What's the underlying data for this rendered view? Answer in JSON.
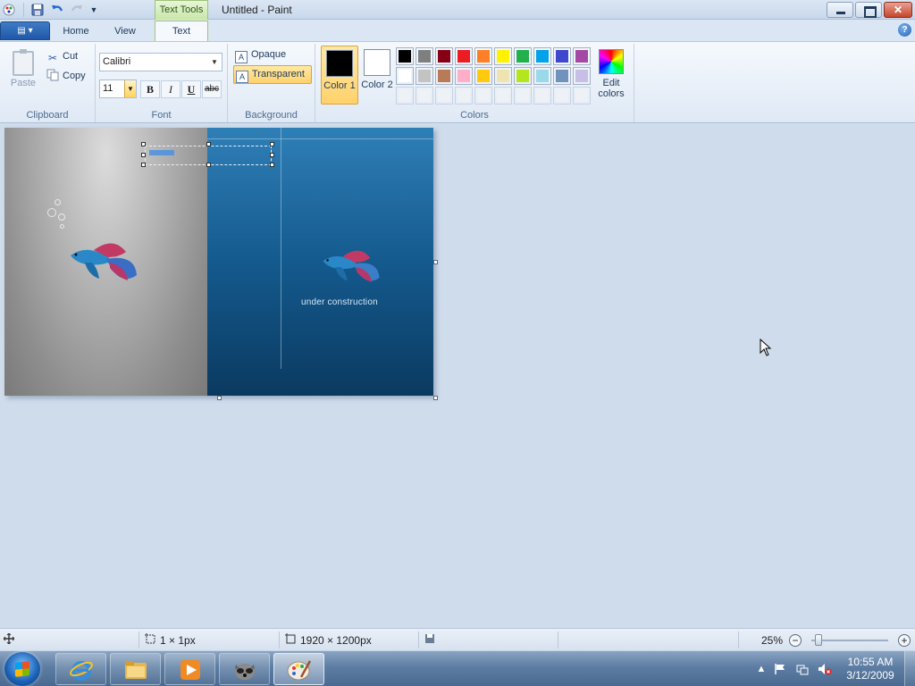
{
  "window": {
    "title": "Untitled - Paint",
    "contextual_tab_group": "Text Tools"
  },
  "tabs": {
    "home": "Home",
    "view": "View",
    "text": "Text"
  },
  "clipboard": {
    "paste": "Paste",
    "cut": "Cut",
    "copy": "Copy",
    "group": "Clipboard"
  },
  "font": {
    "family": "Calibri",
    "size": "11",
    "bold": "B",
    "italic": "I",
    "underline": "U",
    "strike": "abc",
    "group": "Font"
  },
  "background": {
    "opaque": "Opaque",
    "transparent": "Transparent",
    "group": "Background",
    "selected": "Transparent"
  },
  "colors": {
    "color1_label": "Color 1",
    "color2_label": "Color 2",
    "edit_label": "Edit colors",
    "group": "Colors",
    "color1": "#000000",
    "color2": "#ffffff",
    "palette_row1": [
      "#000000",
      "#7f7f7f",
      "#880015",
      "#ed1c24",
      "#ff7f27",
      "#fff200",
      "#22b14c",
      "#00a2e8",
      "#3f48cc",
      "#a349a4"
    ],
    "palette_row2": [
      "#ffffff",
      "#c3c3c3",
      "#b97a57",
      "#ffaec9",
      "#ffc90e",
      "#efe4b0",
      "#b5e61d",
      "#99d9ea",
      "#7092be",
      "#c8bfe7"
    ]
  },
  "canvas": {
    "caption": "under construction"
  },
  "status": {
    "selection_size": "1 × 1px",
    "image_size": "1920 × 1200px",
    "zoom": "25%"
  },
  "taskbar": {
    "time": "10:55 AM",
    "date": "3/12/2009"
  }
}
